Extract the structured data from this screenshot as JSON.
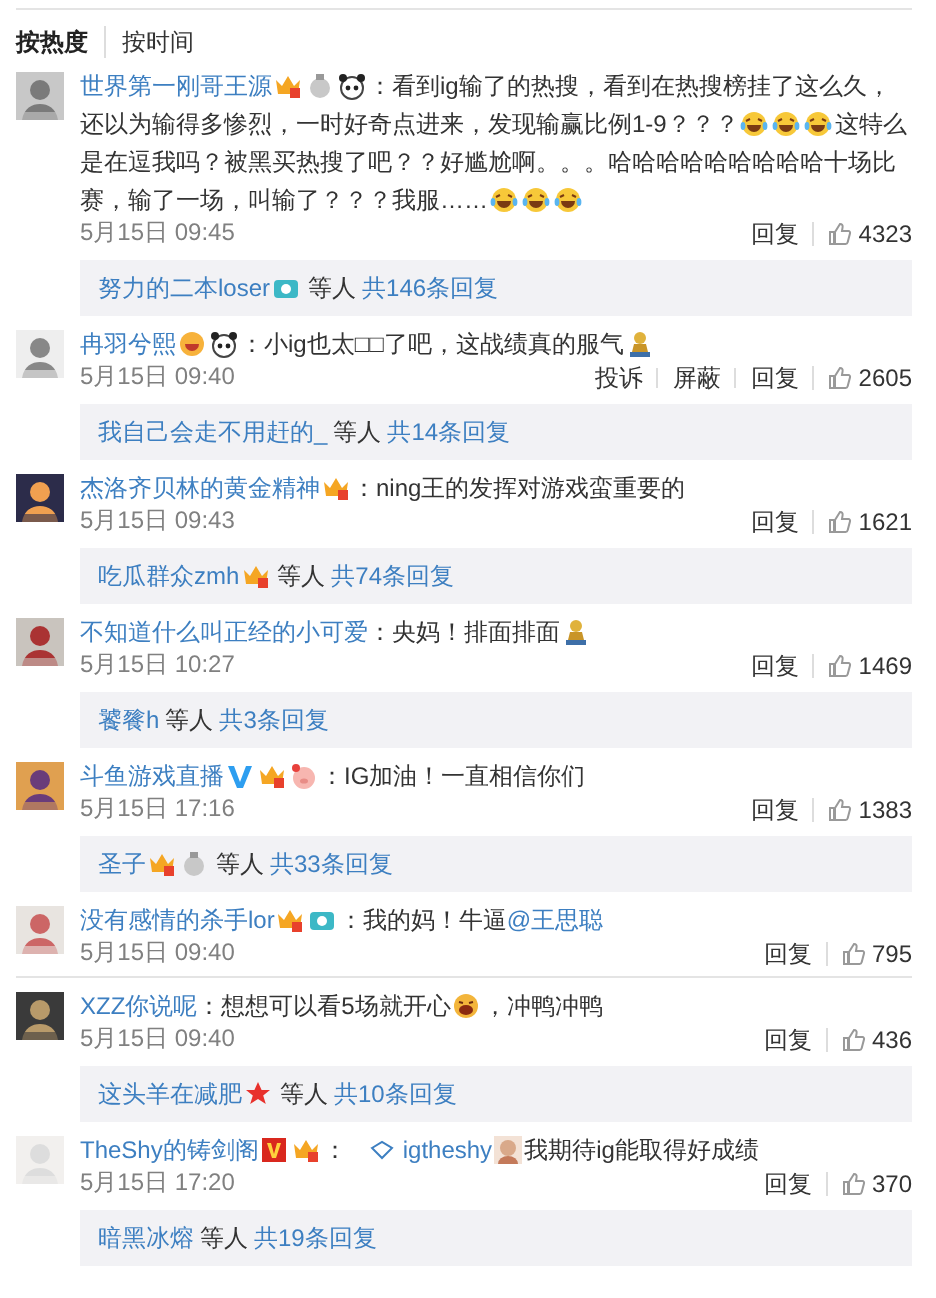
{
  "sort_tabs": [
    {
      "label": "按热度",
      "selected": true
    },
    {
      "label": "按时间",
      "selected": false
    }
  ],
  "comments": [
    {
      "user": "世界第一刚哥王源",
      "badges": [
        {
          "kind": "crown"
        },
        {
          "kind": "medal"
        },
        {
          "kind": "panda"
        }
      ],
      "parts": [
        {
          "kind": "text",
          "text": "：看到ig输了的热搜，看到在热搜榜挂了这么久，还以为输得多惨烈，一时好奇点进来，发现输赢比例1-9？？？"
        },
        {
          "kind": "laugh"
        },
        {
          "kind": "laugh"
        },
        {
          "kind": "laugh"
        },
        {
          "kind": "text",
          "text": "这特么是在逗我吗？被黑买热搜了吧？？好尴尬啊。。。哈哈哈哈哈哈哈哈哈十场比赛，输了一场，叫输了？？？我服……"
        },
        {
          "kind": "laugh"
        },
        {
          "kind": "laugh"
        },
        {
          "kind": "laugh"
        }
      ],
      "time": "5月15日 09:45",
      "actions": [
        "回复"
      ],
      "likes": "4323",
      "replies": {
        "users": [
          {
            "name": "努力的二本loser",
            "badges": [
              {
                "kind": "camera"
              }
            ]
          }
        ],
        "suffix": "等人",
        "total": "共146条回复"
      }
    },
    {
      "user": "冉羽兮熙",
      "badges": [
        {
          "kind": "grin"
        },
        {
          "kind": "panda"
        }
      ],
      "parts": [
        {
          "kind": "text",
          "text": "：小ig也太□□了吧，这战绩真的服气"
        },
        {
          "kind": "figure"
        }
      ],
      "time": "5月15日 09:40",
      "actions": [
        "投诉",
        "屏蔽",
        "回复"
      ],
      "likes": "2605",
      "replies": {
        "users": [
          {
            "name": "我自己会走不用赶的_"
          }
        ],
        "suffix": "等人",
        "total": "共14条回复"
      }
    },
    {
      "user": "杰洛齐贝林的黄金精神",
      "badges": [
        {
          "kind": "crown"
        }
      ],
      "parts": [
        {
          "kind": "text",
          "text": "：ning王的发挥对游戏蛮重要的"
        }
      ],
      "time": "5月15日 09:43",
      "actions": [
        "回复"
      ],
      "likes": "1621",
      "replies": {
        "users": [
          {
            "name": "吃瓜群众zmh",
            "badges": [
              {
                "kind": "crown"
              }
            ]
          }
        ],
        "suffix": "等人",
        "total": "共74条回复"
      }
    },
    {
      "user": "不知道什么叫正经的小可爱",
      "parts": [
        {
          "kind": "text",
          "text": "：央妈！排面排面"
        },
        {
          "kind": "figure"
        }
      ],
      "time": "5月15日 10:27",
      "actions": [
        "回复"
      ],
      "likes": "1469",
      "replies": {
        "users": [
          {
            "name": "饕餮h"
          }
        ],
        "suffix": "等人",
        "total": "共3条回复"
      }
    },
    {
      "user": "斗鱼游戏直播",
      "badges": [
        {
          "kind": "verified-blue"
        },
        {
          "kind": "crown"
        },
        {
          "kind": "pig"
        }
      ],
      "parts": [
        {
          "kind": "text",
          "text": "：IG加油！一直相信你们"
        }
      ],
      "time": "5月15日 17:16",
      "actions": [
        "回复"
      ],
      "likes": "1383",
      "replies": {
        "users": [
          {
            "name": "圣子",
            "badges": [
              {
                "kind": "crown"
              },
              {
                "kind": "medal"
              }
            ]
          }
        ],
        "suffix": "等人",
        "total": "共33条回复"
      }
    },
    {
      "user": "没有感情的杀手lor",
      "badges": [
        {
          "kind": "crown"
        },
        {
          "kind": "camera"
        }
      ],
      "parts": [
        {
          "kind": "text",
          "text": "：我的妈！牛逼"
        },
        {
          "kind": "mention",
          "text": "@王思聪"
        }
      ],
      "time": "5月15日 09:40",
      "actions": [
        "回复"
      ],
      "likes": "795"
    },
    {
      "user": "XZZ你说呢",
      "parts": [
        {
          "kind": "text",
          "text": "：想想可以看5场就开心"
        },
        {
          "kind": "mouth-open"
        },
        {
          "kind": "text",
          "text": "，冲鸭冲鸭"
        }
      ],
      "time": "5月15日 09:40",
      "actions": [
        "回复"
      ],
      "likes": "436",
      "replies": {
        "users": [
          {
            "name": "这头羊在减肥",
            "badges": [
              {
                "kind": "star"
              }
            ]
          }
        ],
        "suffix": "等人",
        "total": "共10条回复"
      }
    },
    {
      "user": "TheShy的铸剑阁",
      "badges": [
        {
          "kind": "verified-red"
        },
        {
          "kind": "crown"
        }
      ],
      "parts": [
        {
          "kind": "text",
          "text": "："
        },
        {
          "kind": "link",
          "text": "igtheshy"
        },
        {
          "kind": "face"
        },
        {
          "kind": "text",
          "text": "我期待ig能取得好成绩"
        }
      ],
      "time": "5月15日 17:20",
      "actions": [
        "回复"
      ],
      "likes": "370",
      "replies": {
        "users": [
          {
            "name": "暗黑冰熔"
          }
        ],
        "suffix": "等人",
        "total": "共19条回复"
      }
    }
  ]
}
